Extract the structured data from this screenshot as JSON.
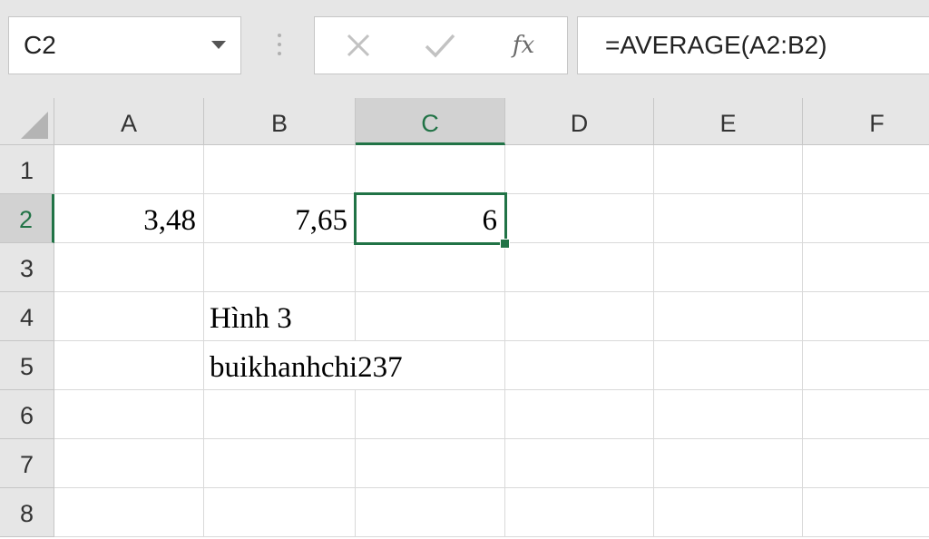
{
  "formula_bar": {
    "name_box": "C2",
    "fx_label": "fx",
    "formula": "=AVERAGE(A2:B2)"
  },
  "columns": [
    "A",
    "B",
    "C",
    "D",
    "E",
    "F"
  ],
  "rows": [
    "1",
    "2",
    "3",
    "4",
    "5",
    "6",
    "7",
    "8"
  ],
  "selected": {
    "column": "C",
    "row": "2"
  },
  "cells": {
    "A2": "3,48",
    "B2": "7,65",
    "C2": "6",
    "B4": "Hình 3",
    "B5": "buikhanhchi237"
  },
  "colors": {
    "selection": "#217346",
    "header_bg": "#e6e6e6",
    "gridline": "#d9d9d9"
  },
  "icons": {
    "cancel": "close-icon",
    "enter": "check-icon",
    "function": "fx-icon",
    "name_box_dropdown": "chevron-down-icon",
    "select_all": "select-all-triangle-icon"
  }
}
